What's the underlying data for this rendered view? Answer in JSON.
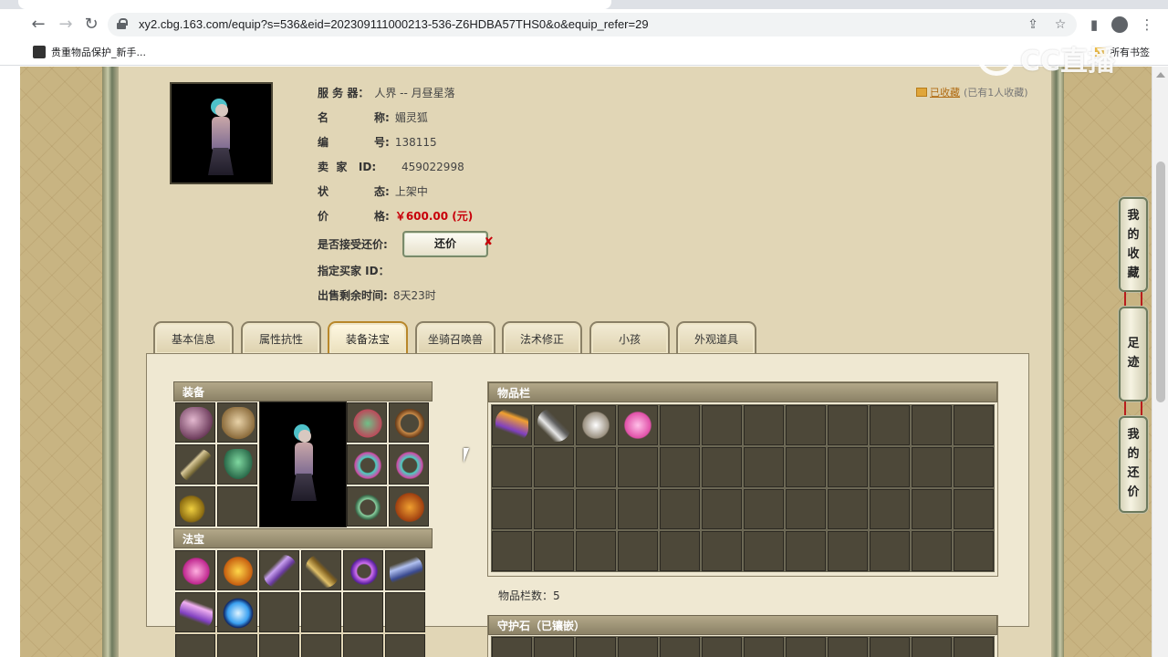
{
  "browser": {
    "url": "xy2.cbg.163.com/equip?s=536&eid=202309111000213-536-Z6HDBA57THS0&o&equip_refer=29",
    "bookmark": "贵重物品保护_新手...",
    "bookmark_right": "所有书签"
  },
  "watermark": "CC直播",
  "item": {
    "server_label": "服 务 器：",
    "server_value": "人界 -- 月昼星落",
    "name_label_a": "名",
    "name_label_b": "称:",
    "name_value": "媚灵狐",
    "id_label_a": "编",
    "id_label_b": "号:",
    "id_value": "138115",
    "seller_label": "卖  家   ID:",
    "seller_value": "459022998",
    "status_label_a": "状",
    "status_label_b": "态:",
    "status_value": "上架中",
    "price_label_a": "价",
    "price_label_b": "格:",
    "price_value": "￥600.00 (元)",
    "counter_label": "是否接受还价:",
    "counter_button": "还价",
    "counter_mark": "✘",
    "buyer_label": "指定买家 ID：",
    "remaining_label": "出售剩余时间:",
    "remaining_value": "8天23时"
  },
  "favorite": {
    "link": "已收藏",
    "count": "(已有1人收藏)"
  },
  "tabs": [
    "基本信息",
    "属性抗性",
    "装备法宝",
    "坐骑召唤兽",
    "法术修正",
    "小孩",
    "外观道具"
  ],
  "equip": {
    "title": "装备",
    "treasure_title": "法宝"
  },
  "inventory": {
    "title": "物品栏",
    "count": "物品栏数：5"
  },
  "guard": {
    "title": "守护石（已镶嵌）"
  },
  "side_buttons": [
    "我的收藏",
    "足迹",
    "我的还价"
  ]
}
